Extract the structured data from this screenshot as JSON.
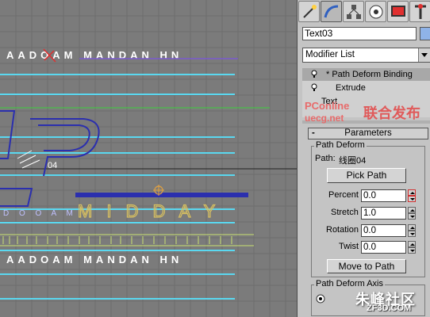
{
  "viewport": {
    "text_rows": [
      "AADOAM MANDAN HN",
      "AADOAM MANDAN HN"
    ],
    "midday_text": "M I D D A Y"
  },
  "toolbar": {
    "tabs": [
      "create-icon",
      "modify-icon",
      "hierarchy-icon",
      "motion-icon",
      "display-icon",
      "utilities-icon"
    ]
  },
  "object": {
    "name": "Text03",
    "color": "#8fb3e8"
  },
  "modifier_list": {
    "selected": "Modifier List"
  },
  "stack": {
    "items": [
      {
        "label": "* Path Deform Binding"
      },
      {
        "label": "Extrude"
      },
      {
        "label": "Text"
      }
    ]
  },
  "watermark_top": {
    "line1": "PConline",
    "line2": "uecg.net",
    "cn": "联合发布"
  },
  "parameters": {
    "rollout_title": "Parameters",
    "group_path_deform": "Path Deform",
    "path_label": "Path:",
    "path_value": "线圈04",
    "pick_path": "Pick Path",
    "percent_label": "Percent",
    "percent_value": "0.0",
    "stretch_label": "Stretch",
    "stretch_value": "1.0",
    "rotation_label": "Rotation",
    "rotation_value": "0.0",
    "twist_label": "Twist",
    "twist_value": "0.0",
    "move_to_path": "Move to Path",
    "group_axis": "Path Deform Axis"
  },
  "watermark_bottom": {
    "cn": "朱峰社区",
    "url": "ZF3D.COM"
  }
}
